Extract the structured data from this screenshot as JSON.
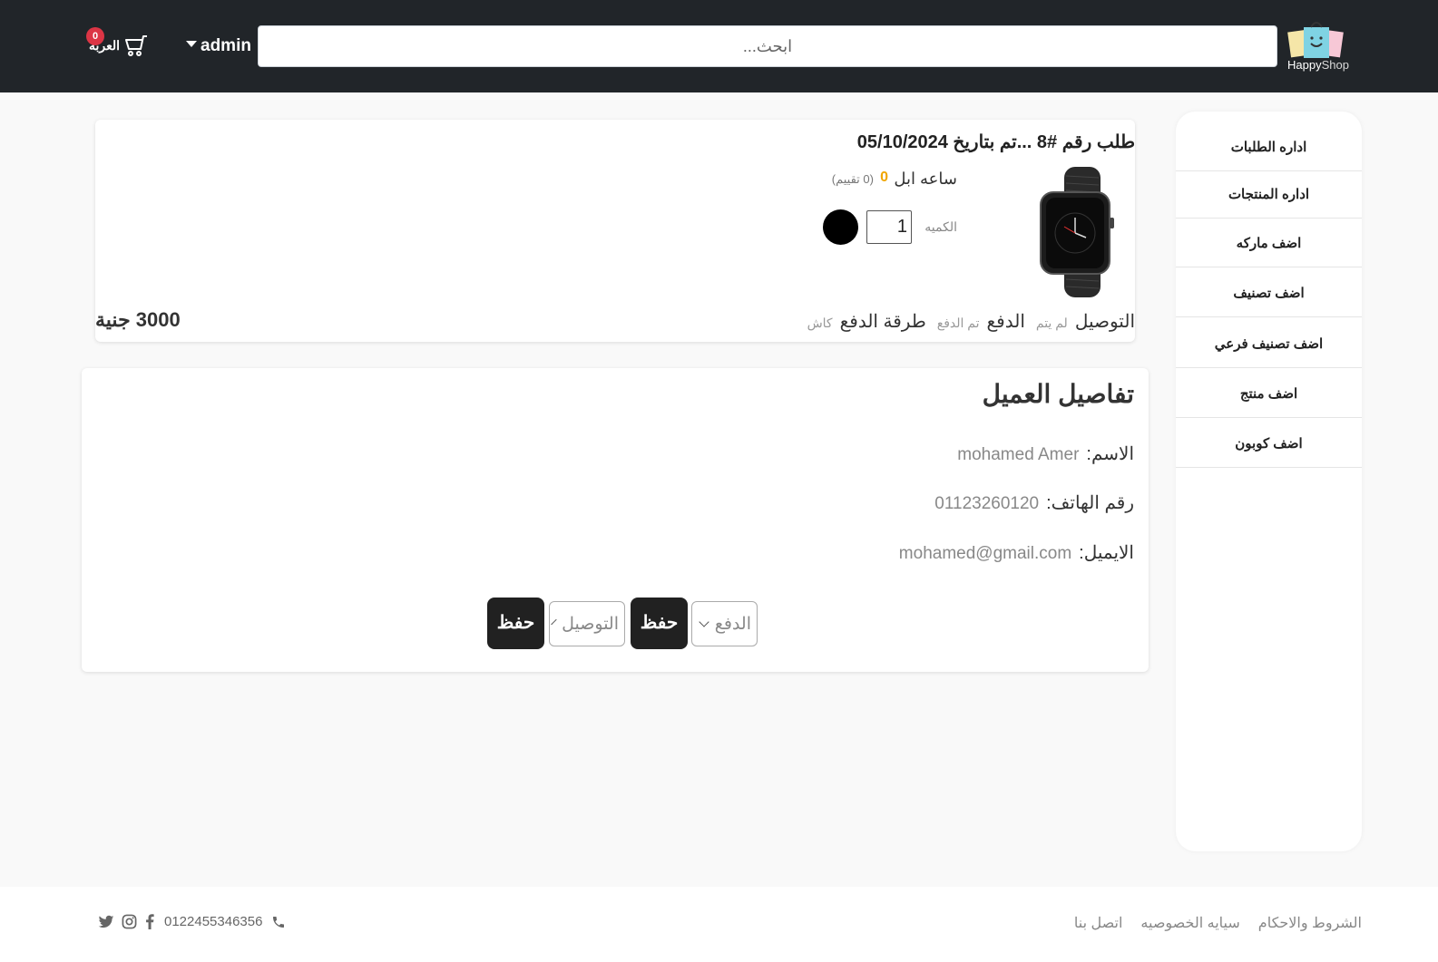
{
  "header": {
    "logo_text_a": "Happy",
    "logo_text_b": "Shop",
    "search_placeholder": "ابحث...",
    "user_label": "admin",
    "cart_label": "العربه",
    "cart_count": "0"
  },
  "sidebar": {
    "items": [
      {
        "label": "اداره الطلبات"
      },
      {
        "label": "اداره المنتجات"
      },
      {
        "label": "اضف ماركه"
      },
      {
        "label": "اضف تصنيف"
      },
      {
        "label": "اضف تصنيف فرعي"
      },
      {
        "label": "اضف منتج"
      },
      {
        "label": "اضف كوبون"
      }
    ]
  },
  "order": {
    "title": "طلب رقم #8 ...تم بتاريخ 05/10/2024",
    "product_name": "ساعه ابل",
    "rating": "0",
    "rating_count": "(0 تقييم)",
    "qty_label": "الكميه",
    "qty_value": "1",
    "color": "#000000",
    "delivery_label": "التوصيل",
    "delivery_status": "لم يتم",
    "payment_label": "الدفع",
    "payment_status": "تم الدفع",
    "method_label": "طرقة الدفع",
    "method_value": "كاش",
    "price": "3000 جنية"
  },
  "customer": {
    "title": "تفاصيل العميل",
    "name_label": "الاسم:",
    "name_value": "mohamed Amer",
    "phone_label": "رقم الهاتف:",
    "phone_value": "01123260120",
    "email_label": "الايميل:",
    "email_value": "mohamed@gmail.com",
    "payment_select": "الدفع",
    "delivery_select": "التوصيل",
    "save_label": "حفظ"
  },
  "footer": {
    "links": [
      "الشروط والاحكام",
      "سيايه الخصوصيه",
      "اتصل بنا"
    ],
    "phone": "0122455346356"
  },
  "colors": {
    "header_bg": "#212529",
    "rating": "#f0a500",
    "badge": "#dc3545",
    "button_bg": "#212121"
  }
}
